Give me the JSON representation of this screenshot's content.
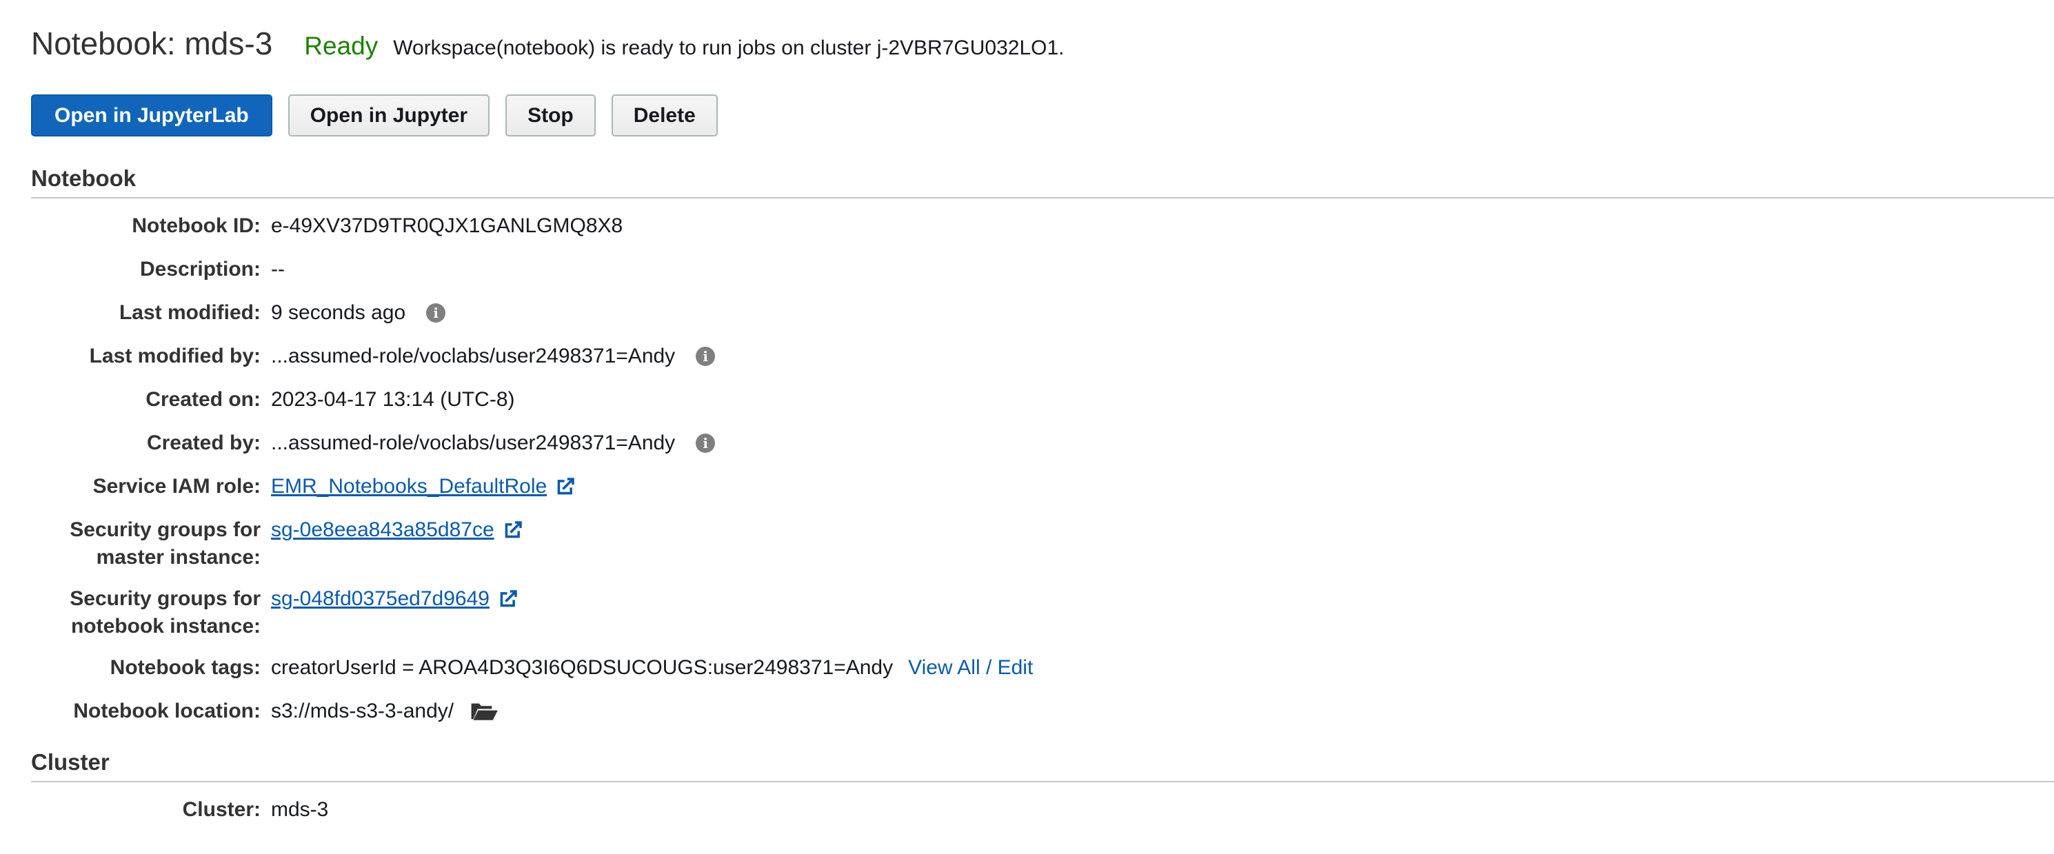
{
  "header": {
    "title": "Notebook: mds-3",
    "status": "Ready",
    "status_description": "Workspace(notebook) is ready to run jobs on cluster j-2VBR7GU032LO1."
  },
  "actions": {
    "open_jupyterlab": "Open in JupyterLab",
    "open_jupyter": "Open in Jupyter",
    "stop": "Stop",
    "delete": "Delete"
  },
  "notebook_section": {
    "title": "Notebook",
    "notebook_id": {
      "label": "Notebook ID:",
      "value": "e-49XV37D9TR0QJX1GANLGMQ8X8"
    },
    "description": {
      "label": "Description:",
      "value": "--"
    },
    "last_modified": {
      "label": "Last modified:",
      "value": "9 seconds ago"
    },
    "last_modified_by": {
      "label": "Last modified by:",
      "value": "...assumed-role/voclabs/user2498371=Andy"
    },
    "created_on": {
      "label": "Created on:",
      "value": "2023-04-17 13:14 (UTC-8)"
    },
    "created_by": {
      "label": "Created by:",
      "value": "...assumed-role/voclabs/user2498371=Andy"
    },
    "service_iam_role": {
      "label": "Service IAM role:",
      "value": "EMR_Notebooks_DefaultRole"
    },
    "sg_master": {
      "label_line1": "Security groups for",
      "label_line2": "master instance:",
      "value": "sg-0e8eea843a85d87ce"
    },
    "sg_notebook": {
      "label_line1": "Security groups for",
      "label_line2": "notebook instance:",
      "value": "sg-048fd0375ed7d9649"
    },
    "tags": {
      "label": "Notebook tags:",
      "value": "creatorUserId = AROA4D3Q3I6Q6DSUCOUGS:user2498371=Andy",
      "link": "View All / Edit"
    },
    "location": {
      "label": "Notebook location:",
      "value": "s3://mds-s3-3-andy/"
    }
  },
  "cluster_section": {
    "title": "Cluster",
    "cluster": {
      "label": "Cluster:",
      "value": "mds-3"
    }
  },
  "colors": {
    "primary_button": "#1166bb",
    "status_ready": "#1d8102",
    "link": "#0a5aad"
  },
  "icons": {
    "info": "info-icon",
    "external_link": "external-link-icon",
    "folder": "folder-open-icon"
  }
}
